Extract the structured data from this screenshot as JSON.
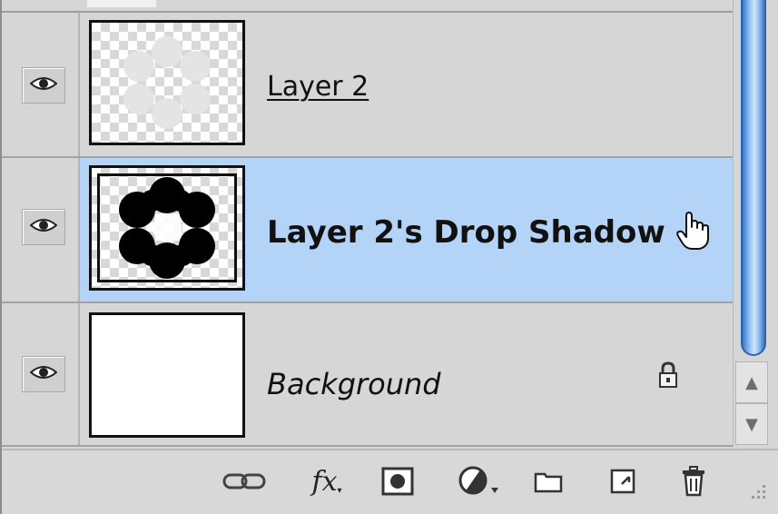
{
  "layers_panel": {
    "layers": [
      {
        "name": "Layer 2",
        "visible": true,
        "selected": false,
        "style": "linked"
      },
      {
        "name": "Layer 2's Drop Shadow",
        "visible": true,
        "selected": true,
        "style": "bold"
      },
      {
        "name": "Background",
        "visible": true,
        "selected": false,
        "style": "italic",
        "locked": true
      }
    ],
    "icons": {
      "visibility": "eye-icon",
      "lock": "lock-icon",
      "cursor": "hand-pointer-icon"
    },
    "toolbar": {
      "link": "link-layers-icon",
      "fx_label": "fx",
      "mask": "add-mask-icon",
      "adjustment": "adjustment-layer-icon",
      "group": "new-group-icon",
      "new_layer": "new-layer-icon",
      "trash": "delete-layer-icon"
    },
    "colors": {
      "panel": "#d6d6d6",
      "selected_row": "#b3d3f7",
      "scroll_thumb": "#6fa3e6"
    }
  }
}
